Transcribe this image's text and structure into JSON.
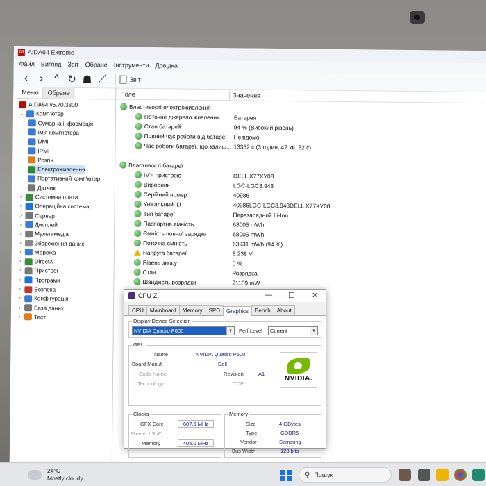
{
  "window": {
    "title": "AIDA64 Extreme"
  },
  "menu": [
    "Файл",
    "Вигляд",
    "Звіт",
    "Обране",
    "Інструменти",
    "Довідка"
  ],
  "toolbar": {
    "report_label": "Звіт"
  },
  "left_tabs": [
    "Меню",
    "Обране"
  ],
  "tree": [
    {
      "label": "AIDA64 v5.70.3800",
      "level": 0,
      "icon": "aida-icon",
      "color": "#b30d0d"
    },
    {
      "label": "Комп'ютер",
      "level": 1,
      "icon": "computer-icon",
      "color": "#3a7bd5",
      "expander": "⌄"
    },
    {
      "label": "Сумарна інформація",
      "level": 2,
      "icon": "summary-icon",
      "color": "#3a7bd5"
    },
    {
      "label": "Ім'я комп'ютера",
      "level": 2,
      "icon": "computer-name-icon",
      "color": "#3a7bd5"
    },
    {
      "label": "DMI",
      "level": 2,
      "icon": "dmi-icon",
      "color": "#3a7bd5"
    },
    {
      "label": "IPMI",
      "level": 2,
      "icon": "ipmi-icon",
      "color": "#3a7bd5"
    },
    {
      "label": "Розгін",
      "level": 2,
      "icon": "overclock-icon",
      "color": "#e07b1a"
    },
    {
      "label": "Електроживлення",
      "level": 2,
      "icon": "power-icon",
      "color": "#2f8a2f",
      "selected": true
    },
    {
      "label": "Портативний комп'ютер",
      "level": 2,
      "icon": "portable-icon",
      "color": "#3a7bd5"
    },
    {
      "label": "Датчик",
      "level": 2,
      "icon": "sensor-icon",
      "color": "#777777"
    },
    {
      "label": "Системна плата",
      "level": 1,
      "icon": "motherboard-icon",
      "color": "#3a8a3a",
      "expander": "›"
    },
    {
      "label": "Операційна система",
      "level": 1,
      "icon": "os-icon",
      "color": "#1a73d9",
      "expander": "›"
    },
    {
      "label": "Сервер",
      "level": 1,
      "icon": "server-icon",
      "color": "#777777",
      "expander": "›"
    },
    {
      "label": "Дисплей",
      "level": 1,
      "icon": "display-icon",
      "color": "#3a7bd5",
      "expander": "›"
    },
    {
      "label": "Мультимедіа",
      "level": 1,
      "icon": "multimedia-icon",
      "color": "#777777",
      "expander": "›"
    },
    {
      "label": "Збереження даних",
      "level": 1,
      "icon": "storage-icon",
      "color": "#888888",
      "expander": "›"
    },
    {
      "label": "Мережа",
      "level": 1,
      "icon": "network-icon",
      "color": "#3a7bd5",
      "expander": "›"
    },
    {
      "label": "DirectX",
      "level": 1,
      "icon": "directx-icon",
      "color": "#3a8a3a",
      "expander": "›"
    },
    {
      "label": "Пристрої",
      "level": 1,
      "icon": "devices-icon",
      "color": "#777777",
      "expander": "›"
    },
    {
      "label": "Програми",
      "level": 1,
      "icon": "programs-icon",
      "color": "#1a73d9",
      "expander": "›"
    },
    {
      "label": "Безпека",
      "level": 1,
      "icon": "security-icon",
      "color": "#c0392b",
      "expander": "›"
    },
    {
      "label": "Конфігурація",
      "level": 1,
      "icon": "config-icon",
      "color": "#3a7bd5",
      "expander": "›"
    },
    {
      "label": "База даних",
      "level": 1,
      "icon": "database-icon",
      "color": "#777777",
      "expander": "›"
    },
    {
      "label": "Тест",
      "level": 1,
      "icon": "benchmark-icon",
      "color": "#e07b1a",
      "expander": "›"
    }
  ],
  "columns": {
    "field": "Поле",
    "value": "Значення"
  },
  "rows": [
    {
      "type": "group",
      "field": "Властивості електроживлення"
    },
    {
      "type": "item",
      "field": "Поточне джерело живлення",
      "value": "Батарея"
    },
    {
      "type": "item",
      "field": "Стан батарей",
      "value": "94 % (Високий рівень)"
    },
    {
      "type": "item",
      "field": "Повний час роботи від батареї",
      "value": "Невідомо"
    },
    {
      "type": "item",
      "field": "Час роботи батареї, що залиш...",
      "value": "13352 с (3 годин, 42 хв, 32 с)"
    },
    {
      "type": "blank"
    },
    {
      "type": "group",
      "field": "Властивості батареї"
    },
    {
      "type": "item",
      "field": "Ім'я пристрою",
      "value": "DELL X77XY08"
    },
    {
      "type": "item",
      "field": "Виробник",
      "value": "LGC-LGC8.948"
    },
    {
      "type": "item",
      "field": "Серійний номер",
      "value": "40986"
    },
    {
      "type": "item",
      "field": "Унікальний ID",
      "value": "40986LGC-LGC8.948DELL X77XY08"
    },
    {
      "type": "item",
      "field": "Тип батареї",
      "value": "Перезарядний Li-Ion"
    },
    {
      "type": "item",
      "field": "Паспортна ємність",
      "value": "68005 mWh"
    },
    {
      "type": "item",
      "field": "Ємність повної зарядки",
      "value": "68005 mWh"
    },
    {
      "type": "item",
      "field": "Поточна ємність",
      "value": "63931 mWh  (94 %)"
    },
    {
      "type": "warn",
      "field": "Напруга батареї",
      "value": "8.238 V"
    },
    {
      "type": "item",
      "field": "Рівень зносу",
      "value": "0 %"
    },
    {
      "type": "item",
      "field": "Стан",
      "value": "Розрядка"
    },
    {
      "type": "item",
      "field": "Швидкість розрядки",
      "value": "21189 mW"
    }
  ],
  "cpuz": {
    "title": "CPU-Z",
    "tabs": [
      "CPU",
      "Mainboard",
      "Memory",
      "SPD",
      "Graphics",
      "Bench",
      "About"
    ],
    "active_tab": "Graphics",
    "display_selection_label": "Display Device Selection",
    "device": "NVIDIA Quadro P600",
    "perf_level_label": "Perf Level",
    "perf_level": "Current",
    "gpu_label": "GPU",
    "gpu": {
      "name_label": "Name",
      "name": "NVIDIA Quadro P600",
      "board_label": "Board Manuf.",
      "board": "Dell",
      "codename_label": "Code Name",
      "revision_label": "Revision",
      "revision": "A1",
      "technology_label": "Technology",
      "tdp_label": "TDP"
    },
    "logo_text": "NVIDIA.",
    "clocks_label": "Clocks",
    "clocks": {
      "gfx_label": "GFX Core",
      "gfx": "607.5 MHz",
      "shader_label": "Shader / SoC",
      "memory_label": "Memory",
      "memory": "405.0 MHz"
    },
    "memory_label": "Memory",
    "memory": {
      "size_label": "Size",
      "size": "4 GBytes",
      "type_label": "Type",
      "type": "GDDR5",
      "vendor_label": "Vendor",
      "vendor": "Samsung",
      "bus_label": "Bus Width",
      "bus": "128 bits"
    }
  },
  "taskbar": {
    "temp": "24°C",
    "weather": "Mostly cloudy",
    "search_placeholder": "Пошук"
  }
}
